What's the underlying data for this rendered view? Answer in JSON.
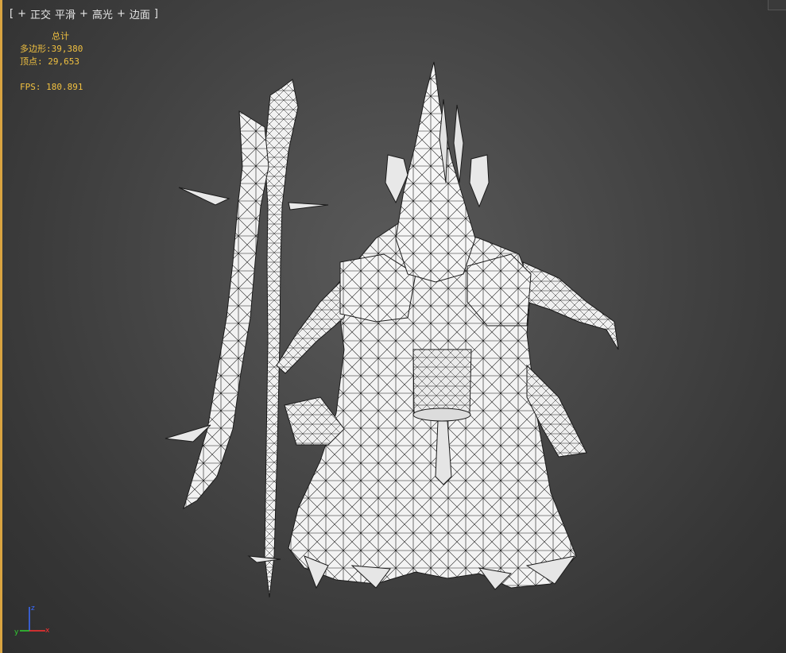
{
  "viewport": {
    "label": {
      "open": "[",
      "plus": "+",
      "view": "正交",
      "shading": "平滑",
      "light_plus": "+",
      "lighting": "高光",
      "edges_plus": "+",
      "edges": "边面",
      "close": "]"
    },
    "stats": {
      "title": "总计",
      "polys_label": "多边形:",
      "polys_value": "39,380",
      "verts_label": "顶点:",
      "verts_value": "29,653",
      "fps_label": "FPS:",
      "fps_value": "180.891"
    },
    "gizmo": {
      "x": "x",
      "y": "y",
      "z": "z"
    }
  },
  "colors": {
    "accent_border": "#d9a441",
    "stats_text": "#f0c040",
    "wire": "#1a1a1a",
    "model_fill": "#f4f4f4"
  }
}
